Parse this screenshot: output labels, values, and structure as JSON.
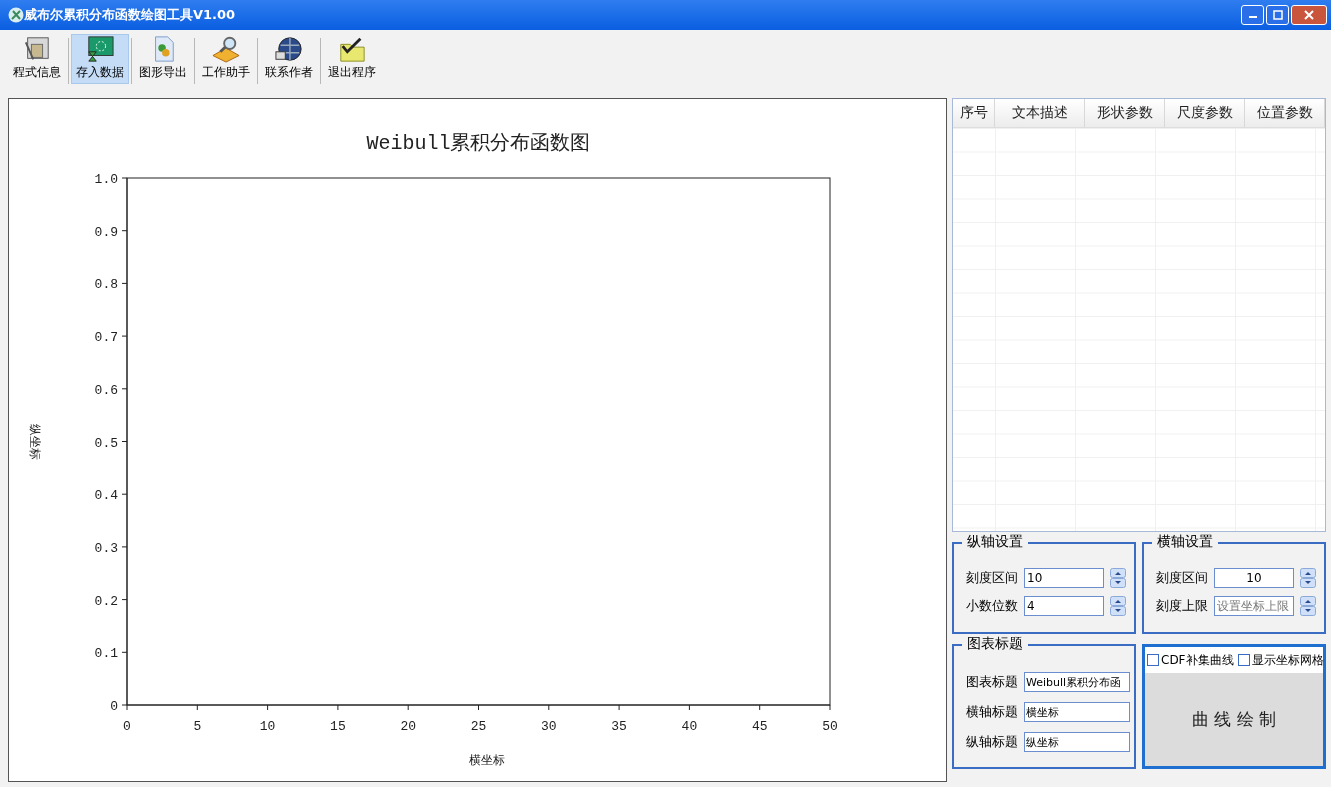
{
  "window": {
    "title": "威布尔累积分布函数绘图工具V1.00"
  },
  "toolbar": [
    {
      "label": "程式信息",
      "selected": false
    },
    {
      "label": "存入数据",
      "selected": true
    },
    {
      "label": "图形导出",
      "selected": false
    },
    {
      "label": "工作助手",
      "selected": false
    },
    {
      "label": "联系作者",
      "selected": false
    },
    {
      "label": "退出程序",
      "selected": false
    }
  ],
  "chart": {
    "chart_data": {
      "type": "line",
      "title": "Weibull累积分布函数图",
      "xlabel": "横坐标",
      "ylabel": "纵坐标",
      "xlim": [
        0,
        50
      ],
      "ylim": [
        0,
        1
      ],
      "xticks": [
        0,
        5,
        10,
        15,
        20,
        25,
        30,
        35,
        40,
        45,
        50
      ],
      "yticks": [
        {
          "value": 0,
          "label": "0"
        },
        {
          "value": 0.1,
          "label": "0.1"
        },
        {
          "value": 0.2,
          "label": "0.2"
        },
        {
          "value": 0.3,
          "label": "0.3"
        },
        {
          "value": 0.4,
          "label": "0.4"
        },
        {
          "value": 0.5,
          "label": "0.5"
        },
        {
          "value": 0.6,
          "label": "0.6"
        },
        {
          "value": 0.7,
          "label": "0.7"
        },
        {
          "value": 0.8,
          "label": "0.8"
        },
        {
          "value": 0.9,
          "label": "0.9"
        },
        {
          "value": 1,
          "label": "1.0"
        }
      ]
    }
  },
  "table": {
    "columns": [
      "序号",
      "文本描述",
      "形状参数",
      "尺度参数",
      "位置参数"
    ]
  },
  "y_axis_settings": {
    "title": "纵轴设置",
    "fields": [
      {
        "label": "刻度区间",
        "value": "10"
      },
      {
        "label": "小数位数",
        "value": "4"
      }
    ]
  },
  "x_axis_settings": {
    "title": "横轴设置",
    "fields": [
      {
        "label": "刻度区间",
        "value": "10"
      },
      {
        "label": "刻度上限",
        "placeholder": "设置坐标上限"
      }
    ]
  },
  "chart_titles": {
    "title": "图表标题",
    "fields": [
      {
        "label": "图表标题",
        "value": "Weibull累积分布函"
      },
      {
        "label": "横轴标题",
        "value": "横坐标"
      },
      {
        "label": "纵轴标题",
        "value": "纵坐标"
      }
    ]
  },
  "options": [
    {
      "label": "CDF补集曲线",
      "checked": false
    },
    {
      "label": "显示坐标网格",
      "checked": false
    }
  ],
  "draw_button": "曲 线 绘 制"
}
